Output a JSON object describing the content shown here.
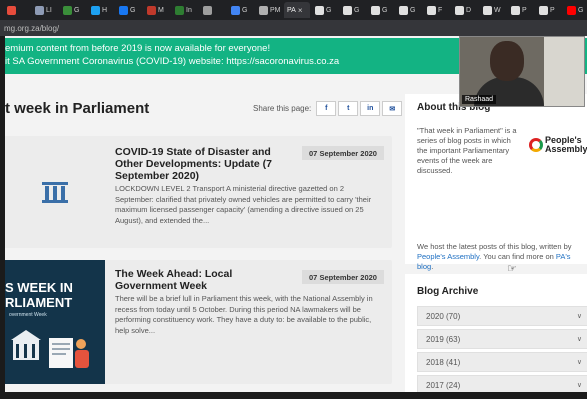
{
  "browser": {
    "tabs": [
      {
        "label": "",
        "color": "#e74c3c"
      },
      {
        "label": "LI",
        "color": "#8e9bb5"
      },
      {
        "label": "G",
        "color": "#3a8e3a"
      },
      {
        "label": "H",
        "color": "#1da1f2"
      },
      {
        "label": "G",
        "color": "#1877f2"
      },
      {
        "label": "M",
        "color": "#c0392b"
      },
      {
        "label": "In",
        "color": "#2e7d32"
      },
      {
        "label": "",
        "color": "#9e9e9e"
      },
      {
        "label": "G",
        "color": "#4285f4"
      },
      {
        "label": "PM",
        "color": "#b0b0b0"
      },
      {
        "label": "G",
        "color": "#e0e0e0"
      },
      {
        "label": "G",
        "color": "#e0e0e0"
      },
      {
        "label": "G",
        "color": "#e0e0e0"
      },
      {
        "label": "G",
        "color": "#e0e0e0"
      },
      {
        "label": "F",
        "color": "#e0e0e0"
      },
      {
        "label": "D",
        "color": "#e0e0e0"
      },
      {
        "label": "W",
        "color": "#e0e0e0"
      },
      {
        "label": "P",
        "color": "#e0e0e0"
      },
      {
        "label": "P",
        "color": "#e0e0e0"
      },
      {
        "label": "G",
        "color": "#ff0000"
      },
      {
        "label": "G",
        "color": "#e0e0e0"
      },
      {
        "label": "G",
        "color": "#1a73e8"
      }
    ],
    "active_tab_label": "PA",
    "new_tab": "+",
    "url": "mg.org.za/blog/"
  },
  "banner": {
    "line1": "emium content from before 2019 is now available for everyone!",
    "line2": "it SA Government Coronavirus (COVID-19) website: https://sacoronavirus.co.za"
  },
  "page_title": "t week in Parliament",
  "share": {
    "label": "Share this page:",
    "buttons": [
      "f",
      "t",
      "in",
      "✉"
    ]
  },
  "posts": [
    {
      "title": "COVID-19 State of Disaster and Other Developments: Update (7 September 2020)",
      "date": "07 September 2020",
      "excerpt": "LOCKDOWN LEVEL 2 Transport A ministerial directive gazetted on 2 September: clarified that privately owned vehicles are permitted to carry 'their maximum licensed passenger capacity' (amending a directive issued on 25 August), and extended the..."
    },
    {
      "title": "The Week Ahead: Local Government Week",
      "date": "07 September 2020",
      "excerpt": "There will be a brief lull in Parliament this week, with the National Assembly in recess from today until 5 October. During this period NA lawmakers will be performing constituency work. They have a duty to: be available to the public, help solve...",
      "image_title": "S WEEK IN\nRLIAMENT",
      "image_subtitle": "overnment Week"
    }
  ],
  "sidebar": {
    "about_title": "About this blog",
    "about_text": "\"That week in Parliament\" is a series of blog posts in which the important Parliamentary events of the week are discussed.",
    "logo_line1": "People's",
    "logo_line2": "Assembly",
    "note_prefix": "We host the latest posts of this blog, written by ",
    "note_link1": "People's Assembly",
    "note_middle": ". You can find more on ",
    "note_link2": "PA's blog",
    "note_suffix": ".",
    "archive_title": "Blog Archive",
    "archive": [
      {
        "label": "2020 (70)"
      },
      {
        "label": "2019 (63)"
      },
      {
        "label": "2018 (41)"
      },
      {
        "label": "2017 (24)"
      }
    ]
  },
  "video": {
    "name": "Rashaad"
  },
  "colors": {
    "banner": "#13b383",
    "link": "#1e6fc2",
    "share_icon": "#1e4f9b"
  }
}
